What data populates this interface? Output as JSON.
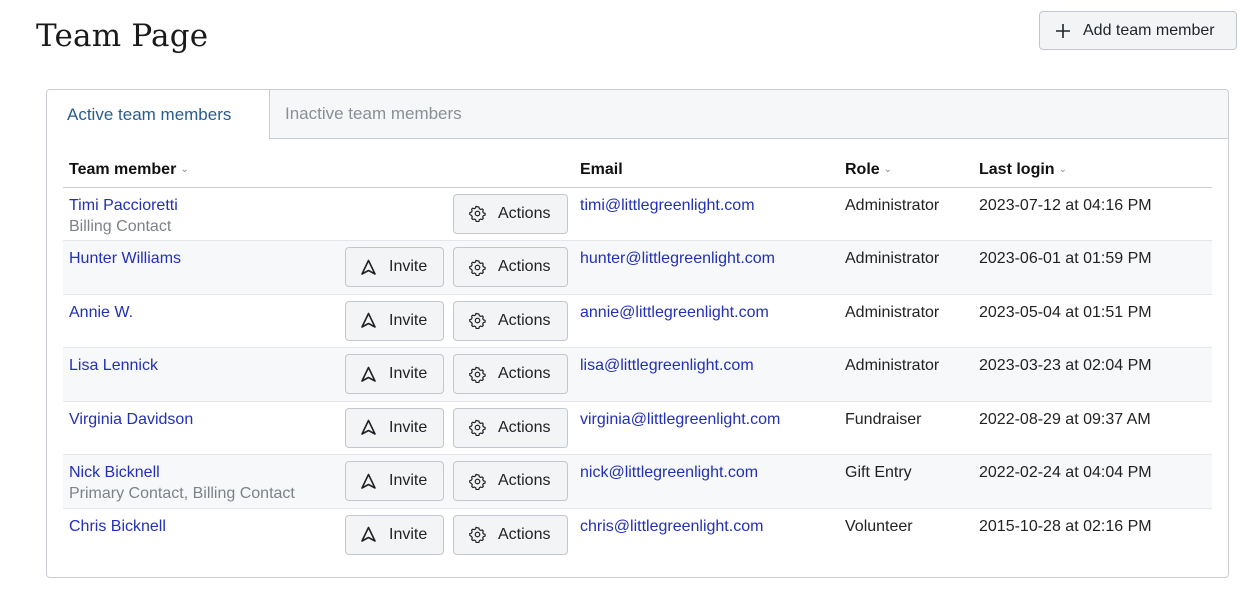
{
  "header": {
    "title": "Team Page",
    "add_button_label": "Add team member"
  },
  "tabs": [
    {
      "label": "Active team members",
      "active": true
    },
    {
      "label": "Inactive team members",
      "active": false
    }
  ],
  "table": {
    "columns": {
      "member": "Team member",
      "email": "Email",
      "role": "Role",
      "last_login": "Last login"
    },
    "sort_icon": "chevron-down-icon",
    "invite_label": "Invite",
    "actions_label": "Actions",
    "rows": [
      {
        "name": "Timi Paccioretti",
        "subtitle": "Billing Contact",
        "has_invite": false,
        "email": "timi@littlegreenlight.com",
        "role": "Administrator",
        "last_login": "2023-07-12 at 04:16 PM"
      },
      {
        "name": "Hunter Williams",
        "subtitle": "",
        "has_invite": true,
        "email": "hunter@littlegreenlight.com",
        "role": "Administrator",
        "last_login": "2023-06-01 at 01:59 PM"
      },
      {
        "name": "Annie W.",
        "subtitle": "",
        "has_invite": true,
        "email": "annie@littlegreenlight.com",
        "role": "Administrator",
        "last_login": "2023-05-04 at 01:51 PM"
      },
      {
        "name": "Lisa Lennick",
        "subtitle": "",
        "has_invite": true,
        "email": "lisa@littlegreenlight.com",
        "role": "Administrator",
        "last_login": "2023-03-23 at 02:04 PM"
      },
      {
        "name": "Virginia Davidson",
        "subtitle": "",
        "has_invite": true,
        "email": "virginia@littlegreenlight.com",
        "role": "Fundraiser",
        "last_login": "2022-08-29 at 09:37 AM"
      },
      {
        "name": "Nick Bicknell",
        "subtitle": "Primary Contact, Billing Contact",
        "has_invite": true,
        "email": "nick@littlegreenlight.com",
        "role": "Gift Entry",
        "last_login": "2022-02-24 at 04:04 PM"
      },
      {
        "name": "Chris Bicknell",
        "subtitle": "",
        "has_invite": true,
        "email": "chris@littlegreenlight.com",
        "role": "Volunteer",
        "last_login": "2015-10-28 at 02:16 PM"
      }
    ]
  },
  "colors": {
    "link": "#2230b5",
    "active_tab": "#2a5c8e",
    "inactive_tab": "#8a8f96",
    "row_alt": "#f7f8fa"
  }
}
